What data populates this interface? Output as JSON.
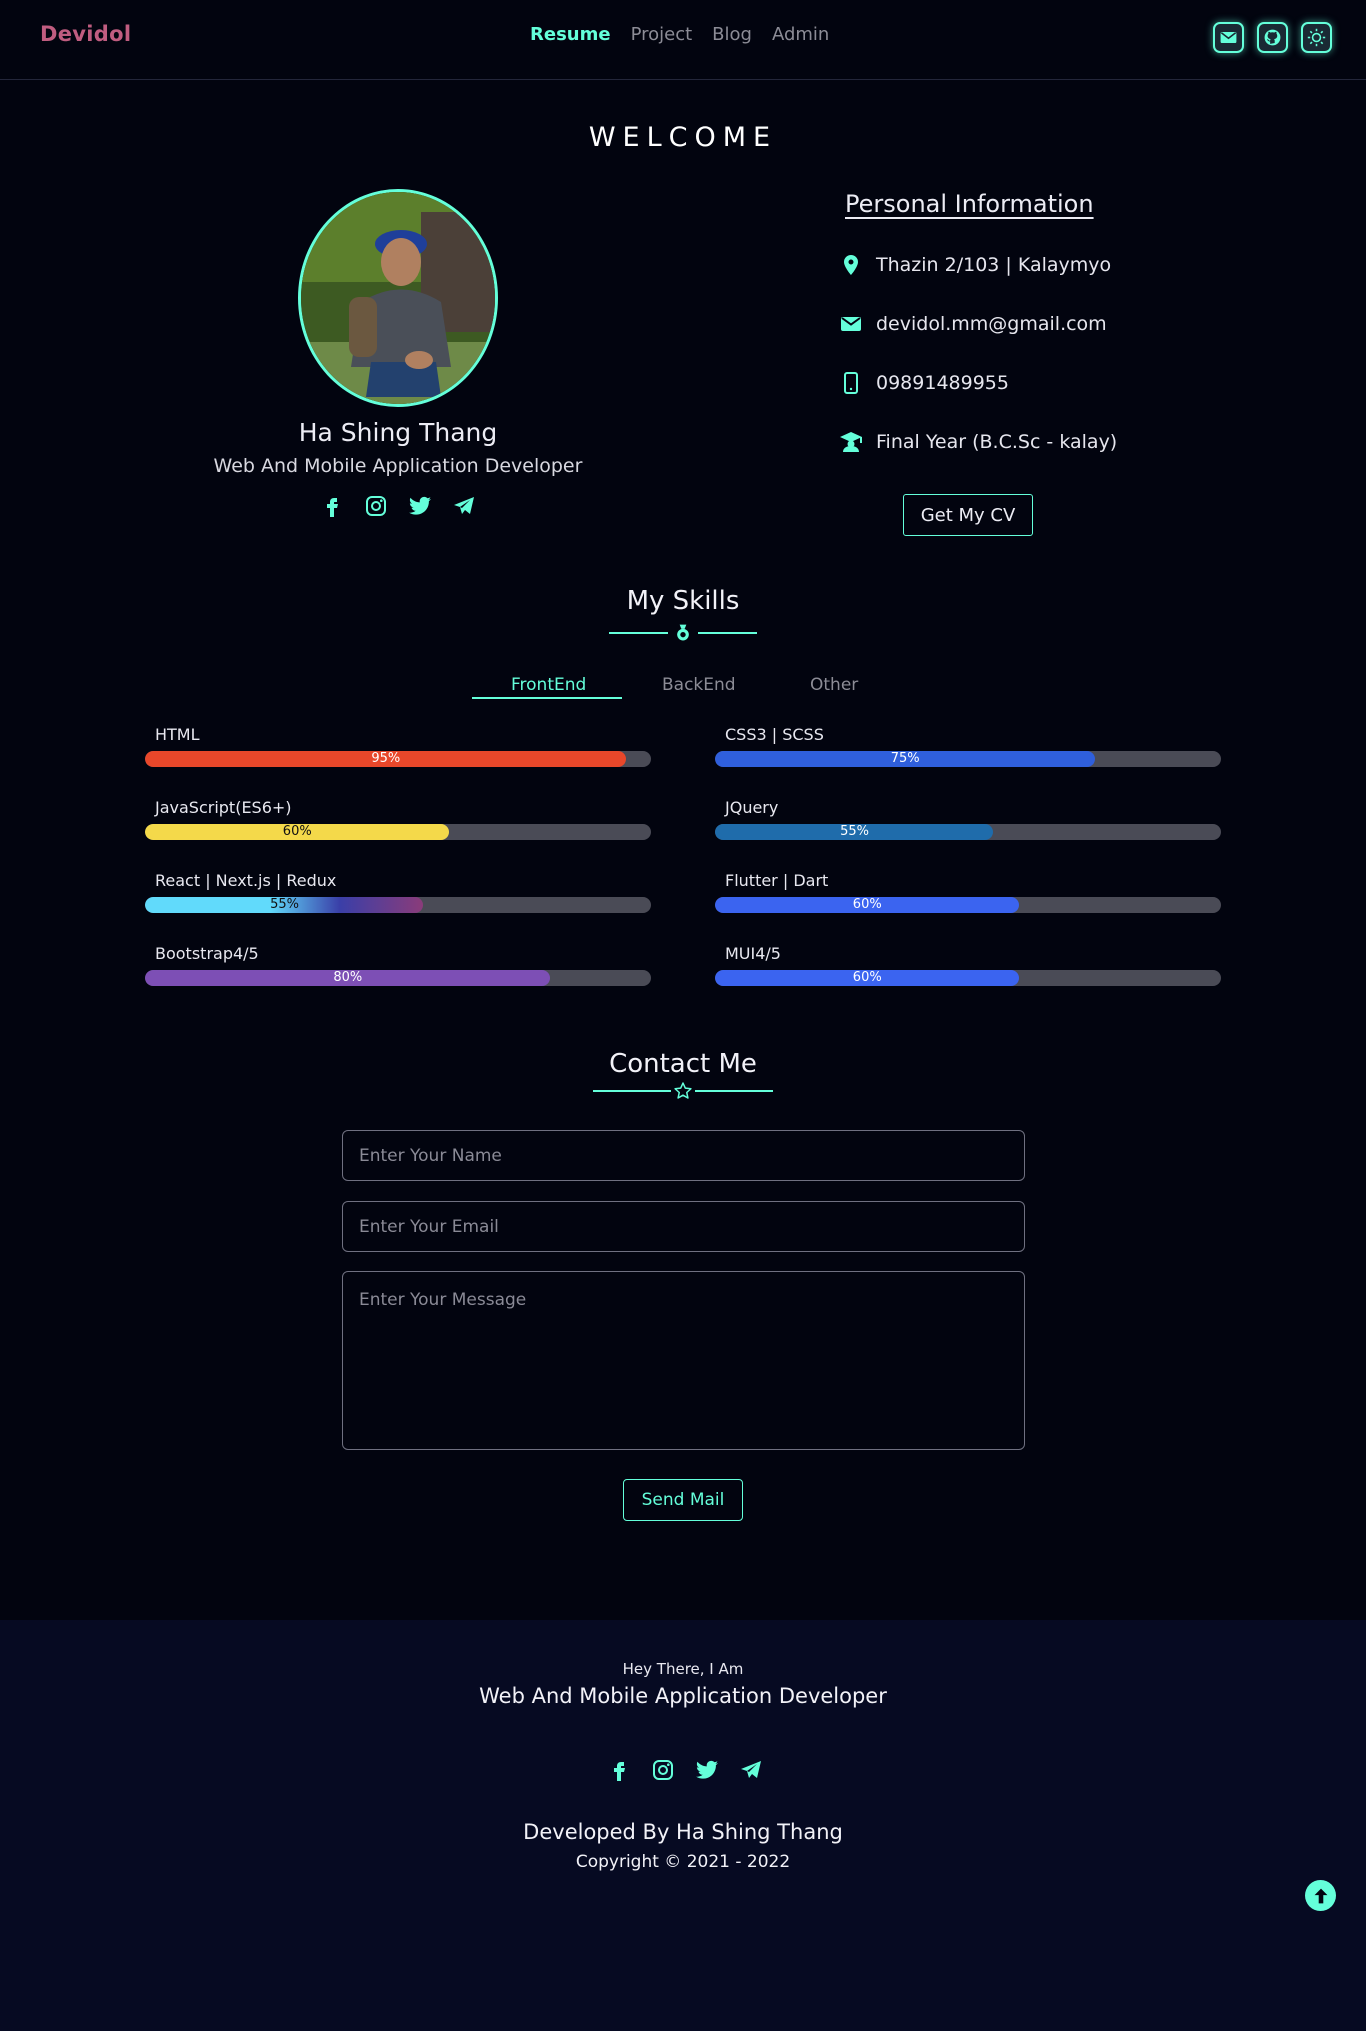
{
  "nav": {
    "brand": "Devidol",
    "links": [
      "Resume",
      "Project",
      "Blog",
      "Admin"
    ],
    "icons": [
      "mail-icon",
      "github-icon",
      "theme-toggle-icon"
    ]
  },
  "welcome": {
    "heading": "WELCOME"
  },
  "profile": {
    "name": "Ha Shing Thang",
    "role": "Web And Mobile Application Developer",
    "socials": [
      "facebook-icon",
      "instagram-icon",
      "twitter-icon",
      "telegram-icon"
    ]
  },
  "personal": {
    "title": "Personal Information",
    "address": "Thazin 2/103 | Kalaymyo",
    "email": "devidol.mm@gmail.com",
    "phone": "09891489955",
    "education": "Final Year (B.C.Sc - kalay)",
    "cv_button": "Get My CV"
  },
  "skills": {
    "title": "My Skills",
    "tabs": [
      "FrontEnd",
      "BackEnd",
      "Other"
    ],
    "active_tab": "FrontEnd",
    "left": [
      {
        "name": "HTML",
        "percent": 95,
        "pct_label": "95%",
        "color": "#e8472a"
      },
      {
        "name": "JavaScript(ES6+)",
        "percent": 60,
        "pct_label": "60%",
        "color": "#f4d94a"
      },
      {
        "name": "React | Next.js | Redux",
        "percent": 55,
        "pct_label": "55%",
        "color": "#61dafb"
      },
      {
        "name": "Bootstrap4/5",
        "percent": 80,
        "pct_label": "80%",
        "color": "#7d4fb5"
      }
    ],
    "right": [
      {
        "name": "CSS3 | SCSS",
        "percent": 75,
        "pct_label": "75%",
        "color": "#2f5fdc"
      },
      {
        "name": "JQuery",
        "percent": 55,
        "pct_label": "55%",
        "color": "#1f6cab"
      },
      {
        "name": "Flutter | Dart",
        "percent": 60,
        "pct_label": "60%",
        "color": "#3b64f0"
      },
      {
        "name": "MUI4/5",
        "percent": 60,
        "pct_label": "60%",
        "color": "#3b64f0"
      }
    ]
  },
  "contact": {
    "title": "Contact Me",
    "name_placeholder": "Enter Your Name",
    "email_placeholder": "Enter Your Email",
    "message_placeholder": "Enter Your Message",
    "send_button": "Send Mail"
  },
  "footer": {
    "greeting": "Hey There, I Am",
    "role": "Web And Mobile Application Developer",
    "developed_by": "Developed By Ha Shing Thang",
    "copyright": "Copyright © 2021 - 2022",
    "socials": [
      "facebook-icon",
      "instagram-icon",
      "twitter-icon",
      "telegram-icon"
    ]
  },
  "colors": {
    "accent": "#64ffda",
    "background": "#02040f",
    "footer": "#060a22",
    "brand": "#c05d80"
  }
}
